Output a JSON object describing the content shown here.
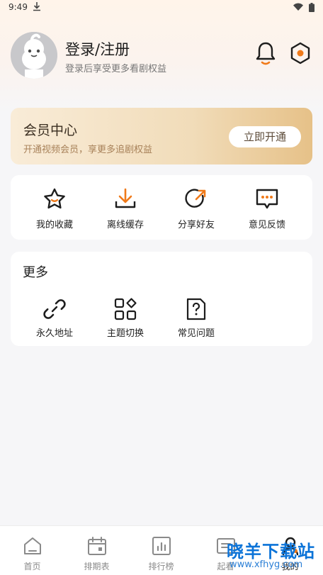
{
  "status_bar": {
    "time": "9:49"
  },
  "profile": {
    "title": "登录/注册",
    "subtitle": "登录后享受更多看剧权益"
  },
  "vip": {
    "title": "会员中心",
    "subtitle": "开通视频会员，享更多追剧权益",
    "button": "立即开通"
  },
  "actions": [
    {
      "label": "我的收藏",
      "icon": "star-icon"
    },
    {
      "label": "离线缓存",
      "icon": "download-icon"
    },
    {
      "label": "分享好友",
      "icon": "share-icon"
    },
    {
      "label": "意见反馈",
      "icon": "feedback-icon"
    }
  ],
  "more": {
    "title": "更多",
    "items": [
      {
        "label": "永久地址",
        "icon": "link-icon"
      },
      {
        "label": "主题切换",
        "icon": "theme-grid-icon"
      },
      {
        "label": "常见问题",
        "icon": "question-doc-icon"
      }
    ]
  },
  "tabbar": [
    {
      "label": "首页",
      "icon": "home-icon"
    },
    {
      "label": "排期表",
      "icon": "calendar-icon"
    },
    {
      "label": "排行榜",
      "icon": "ranking-icon"
    },
    {
      "label": "起看",
      "icon": "watch-icon"
    },
    {
      "label": "我的",
      "icon": "profile-icon",
      "active": true
    }
  ],
  "watermark": {
    "text": "晓羊下载站",
    "url": "www.xfhyg.com"
  },
  "colors": {
    "accent": "#f07a1a",
    "vip_gold": "#e6c188",
    "page_bg": "#f6f6f8"
  }
}
